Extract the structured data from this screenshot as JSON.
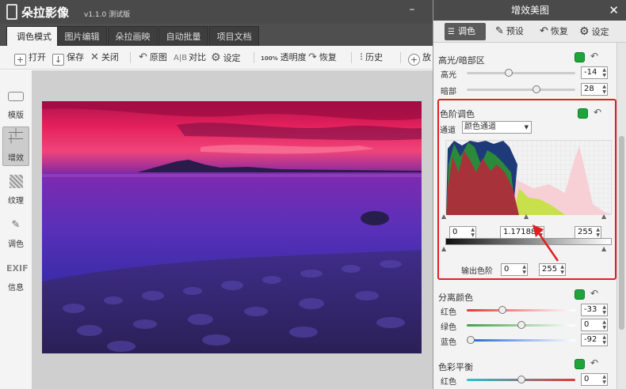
{
  "app": {
    "title": "朵拉影像",
    "version": "v1.1.0 测试版"
  },
  "tabs": [
    "调色模式",
    "图片编辑",
    "朵拉画映",
    "自动批量",
    "项目文档"
  ],
  "toolbar": {
    "open": "打开",
    "save": "保存",
    "close": "关闭",
    "original": "原图",
    "compare_prefix": "A|B",
    "compare": "对比",
    "settings": "设定",
    "opacity_prefix": "100%",
    "opacity": "透明度",
    "restore": "恢复",
    "history": "历史",
    "zoom": "放"
  },
  "leftbar": [
    {
      "label": "模版",
      "icon": "template-icon"
    },
    {
      "label": "增效",
      "icon": "enhance-icon"
    },
    {
      "label": "纹理",
      "icon": "texture-icon"
    },
    {
      "label": "调色",
      "icon": "magic-wand-icon"
    },
    {
      "label": "信息",
      "icon": "exif-icon",
      "icon_text": "EXIF"
    }
  ],
  "panel": {
    "title": "增效美图",
    "tabs": [
      "调色",
      "预设",
      "恢复",
      "设定"
    ],
    "highlights": {
      "title": "高光/暗部区",
      "rows": [
        {
          "label": "高光",
          "value": "-14",
          "pos": 0.39
        },
        {
          "label": "暗部",
          "value": "28",
          "pos": 0.64
        }
      ]
    },
    "levels": {
      "title": "色阶调色",
      "channel_label": "通道",
      "channel_value": "颜色通道",
      "input_black": "0",
      "input_gamma": "1.17188",
      "input_white": "255",
      "output_label": "输出色阶",
      "output_black": "0",
      "output_white": "255"
    },
    "color_separate": {
      "title": "分离颜色",
      "rows": [
        {
          "label": "红色",
          "value": "-33",
          "pos": 0.33,
          "color": "#e53935"
        },
        {
          "label": "绿色",
          "value": "0",
          "pos": 0.5,
          "color": "#43a047"
        },
        {
          "label": "蓝色",
          "value": "-92",
          "pos": 0.04,
          "color": "#1e63d6"
        }
      ]
    },
    "color_balance": {
      "title": "色彩平衡",
      "rows": [
        {
          "label": "红色",
          "value": "0",
          "pos": 0.5
        }
      ]
    }
  }
}
